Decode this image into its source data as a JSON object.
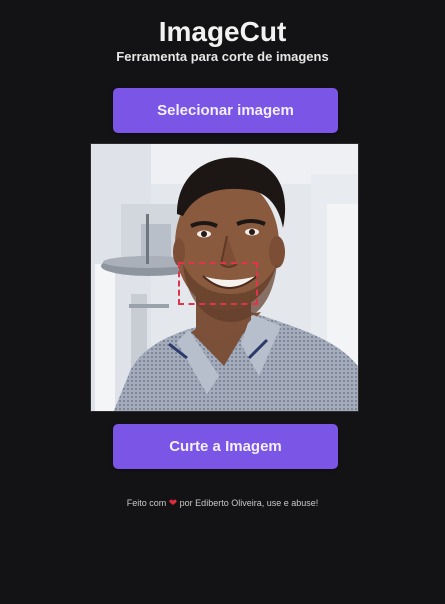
{
  "header": {
    "title": "ImageCut",
    "subtitle": "Ferramenta para corte de imagens"
  },
  "actions": {
    "select_label": "Selecionar imagem",
    "crop_label": "Curte a Imagem"
  },
  "image": {
    "alt": "Foto de um homem sorrindo"
  },
  "footer": {
    "prefix": "Feito com",
    "suffix": "por Ediberto Oliveira, use e abuse!"
  },
  "colors": {
    "background": "#131214",
    "accent": "#7b55e6",
    "selection": "#e0344e",
    "heart": "#e02b3c"
  },
  "icons": {
    "heart": "heart-icon"
  }
}
